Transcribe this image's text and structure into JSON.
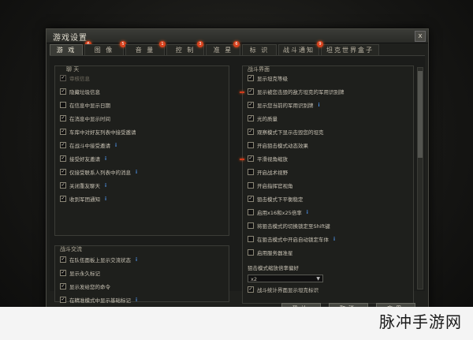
{
  "window": {
    "title": "游戏设置",
    "close_glyph": "x"
  },
  "tabs": [
    {
      "label": "游 戏",
      "badge": "6",
      "active": true
    },
    {
      "label": "图 像",
      "badge": "5",
      "active": false
    },
    {
      "label": "音 量",
      "badge": "1",
      "active": false
    },
    {
      "label": "控 制",
      "badge": "3",
      "active": false
    },
    {
      "label": "准 星",
      "badge": "6",
      "active": false
    },
    {
      "label": "标 识",
      "badge": "",
      "active": false
    },
    {
      "label": "战斗通知",
      "badge": "",
      "active": false
    },
    {
      "label": "坦克世界盒子",
      "badge": "9",
      "active": false
    }
  ],
  "chat": {
    "title": "聊 天",
    "items": [
      {
        "label": "审核信息",
        "checked": true,
        "dim": true,
        "info": false
      },
      {
        "label": "隐藏垃圾信息",
        "checked": true,
        "dim": false,
        "info": false
      },
      {
        "label": "在信息中显示日期",
        "checked": false,
        "dim": false,
        "info": false
      },
      {
        "label": "在消息中显示时间",
        "checked": true,
        "dim": false,
        "info": false
      },
      {
        "label": "车库中对好友列表中接受邀请",
        "checked": true,
        "dim": false,
        "info": false
      },
      {
        "label": "在战斗中接受邀请",
        "checked": true,
        "dim": false,
        "info": true
      },
      {
        "label": "接受好友邀请",
        "checked": true,
        "dim": false,
        "info": true
      },
      {
        "label": "仅接受联系人列表中的消息",
        "checked": true,
        "dim": false,
        "info": true
      },
      {
        "label": "关闭重友聊天",
        "checked": true,
        "dim": false,
        "info": true
      },
      {
        "label": "收到军团通知",
        "checked": true,
        "dim": false,
        "info": true
      }
    ]
  },
  "battle_comm": {
    "title": "战斗交流",
    "items": [
      {
        "label": "在队伍面板上显示交流状态",
        "checked": true,
        "dim": false,
        "info": true
      },
      {
        "label": "显示永久标记",
        "checked": true,
        "dim": false,
        "info": false
      },
      {
        "label": "显示发给您的命令",
        "checked": true,
        "dim": false,
        "info": false
      },
      {
        "label": "在精准模式中显示基础标记",
        "checked": true,
        "dim": false,
        "info": true
      }
    ]
  },
  "battle_ui": {
    "title": "战斗界面",
    "items": [
      {
        "label": "显示坦克等级",
        "checked": true,
        "dim": false,
        "info": false,
        "arrow": false
      },
      {
        "label": "显示被您击毁的敌方坦克的军用识别牌",
        "checked": true,
        "dim": false,
        "info": false,
        "arrow": true
      },
      {
        "label": "显示您当前的军用识别牌",
        "checked": true,
        "dim": false,
        "info": true,
        "arrow": false
      },
      {
        "label": "光的质量",
        "checked": true,
        "dim": false,
        "info": false,
        "arrow": false
      },
      {
        "label": "观察模式下显示击毁您的坦克",
        "checked": true,
        "dim": false,
        "info": false,
        "arrow": false
      },
      {
        "label": "开启狙击模式动态效果",
        "checked": false,
        "dim": false,
        "info": false,
        "arrow": false
      },
      {
        "label": "平滑视角缩放",
        "checked": true,
        "dim": false,
        "info": false,
        "arrow": true
      },
      {
        "label": "开启战术视野",
        "checked": false,
        "dim": false,
        "info": false,
        "arrow": false
      },
      {
        "label": "开启指挥官视角",
        "checked": false,
        "dim": false,
        "info": false,
        "arrow": false
      },
      {
        "label": "狙击模式下平衡稳定",
        "checked": true,
        "dim": false,
        "info": false,
        "arrow": false
      },
      {
        "label": "启用x16和x25倍率",
        "checked": false,
        "dim": false,
        "info": true,
        "arrow": false
      },
      {
        "label": "将狙击模式的切换锁定至Shift键",
        "checked": false,
        "dim": false,
        "info": false,
        "arrow": false
      },
      {
        "label": "在狙击模式中开启自动锁定车体",
        "checked": false,
        "dim": false,
        "info": true,
        "arrow": false
      },
      {
        "label": "启用服务器准星",
        "checked": false,
        "dim": false,
        "info": false,
        "arrow": false
      }
    ],
    "zoom_label": "狙击模式缩放倍率偏好",
    "zoom_value": "x2",
    "last_item": {
      "label": "战斗统计界面显示坦克标识",
      "checked": true,
      "info": false
    }
  },
  "buttons": {
    "ok": "确认",
    "cancel": "取消",
    "apply": "应用"
  },
  "watermark": "脉冲手游网",
  "colors": {
    "badge": "#d6411d",
    "info": "#4c8ee0",
    "accent_arrow": "#d03a1c"
  }
}
